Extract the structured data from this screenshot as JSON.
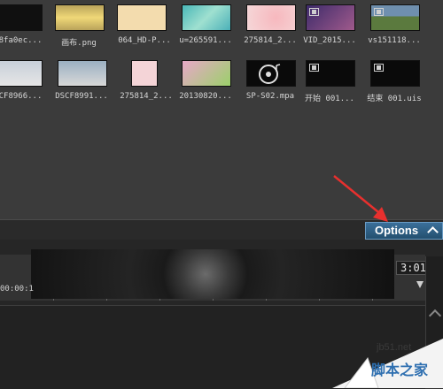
{
  "media": {
    "row1": [
      {
        "label": "8fa0ec...",
        "thumb": "#101010"
      },
      {
        "label": "画布.png",
        "thumb": "#e6d07a"
      },
      {
        "label": "064_HD-P...",
        "thumb": "#f3dcae"
      },
      {
        "label": "u=265591...",
        "thumb": "#67c6c0"
      },
      {
        "label": "275814_2...",
        "thumb": "#f2c7c9"
      },
      {
        "label": "VID_2015...",
        "thumb": "#5a3b7a"
      },
      {
        "label": "vs151118...",
        "thumb": "#6f8fae"
      }
    ],
    "row2": [
      {
        "label": "CF8966...",
        "thumb": "#c7cfd9"
      },
      {
        "label": "DSCF8991...",
        "thumb": "#9bb0c2"
      },
      {
        "label": "275814_2...",
        "thumb": "#f4d4d7"
      },
      {
        "label": "20130820...",
        "thumb": "#9bd06a"
      },
      {
        "label": "SP-S02.mpa",
        "thumb": "#0a0a0a"
      },
      {
        "label": "开始 001...",
        "thumb": "#0a0a0a"
      },
      {
        "label": "结束 001.uis",
        "thumb": "#0a0a0a"
      }
    ]
  },
  "options": {
    "label": "Options"
  },
  "timeline": {
    "time_left": "00:00:1",
    "time_right": "3:01"
  },
  "watermark": {
    "site": "jb51.net",
    "brand": "脚本之家"
  },
  "colors": {
    "arrow": "#e8302e",
    "options_bg": "#2f5f86"
  },
  "icons": [
    "film-icon",
    "music-disc-icon",
    "chevron-up-icon",
    "annotation-arrow"
  ]
}
